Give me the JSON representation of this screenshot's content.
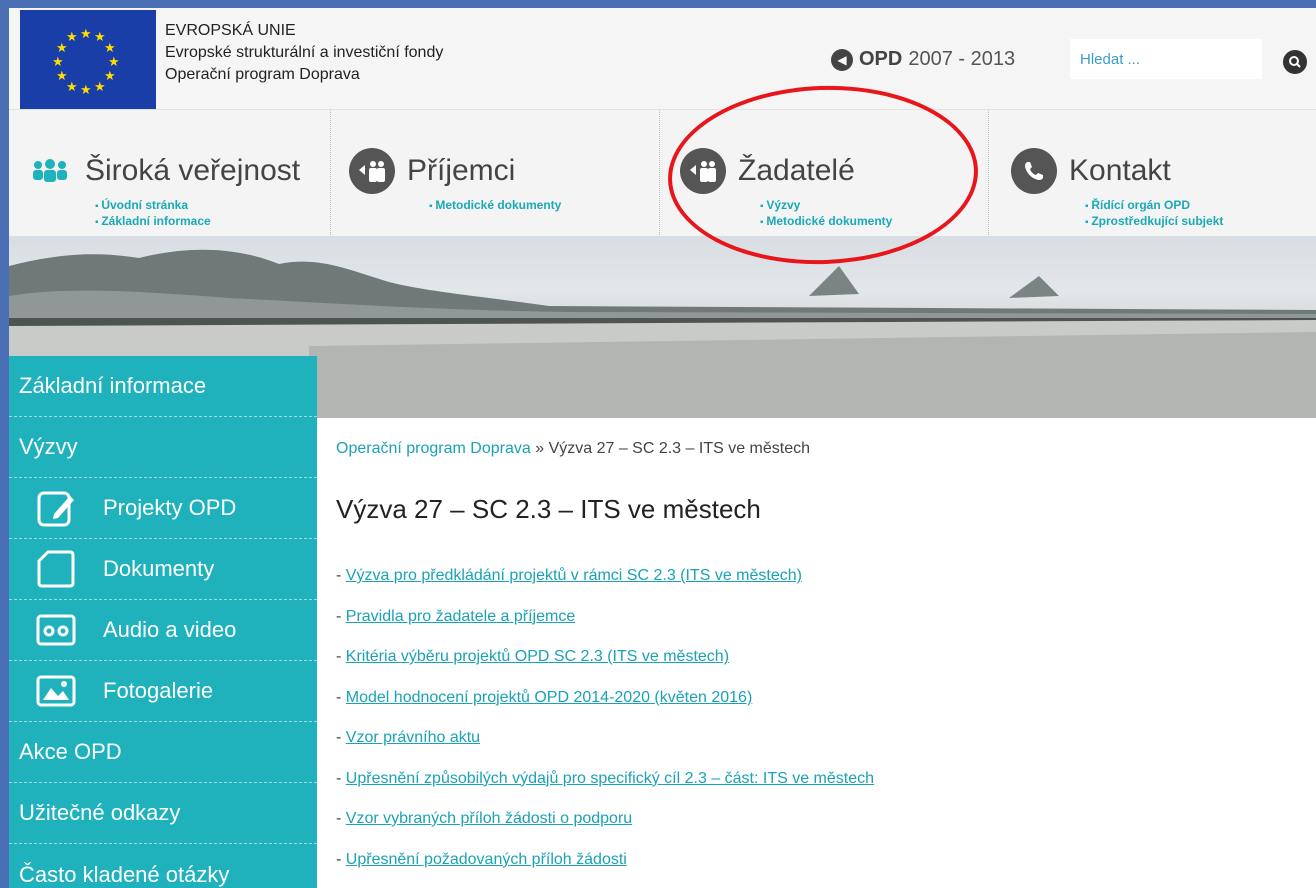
{
  "header": {
    "eu_line1": "EVROPSKÁ UNIE",
    "eu_line2": "Evropské strukturální a investiční fondy",
    "eu_line3": "Operační program Doprava",
    "opd_prefix": "OPD",
    "opd_years": "2007 - 2013",
    "search_placeholder": "Hledat ...",
    "icons": {
      "flag": "eu-flag-icon",
      "back": "arrow-left-circle-icon",
      "search": "search-icon"
    }
  },
  "nav": [
    {
      "title": "Široká veřejnost",
      "icon": "people-icon",
      "links": [
        "Úvodní stránka",
        "Základní informace"
      ]
    },
    {
      "title": "Příjemci",
      "icon": "people-arrow-icon",
      "links": [
        "Metodické dokumenty"
      ]
    },
    {
      "title": "Žadatelé",
      "icon": "people-arrow-icon",
      "links": [
        "Výzvy",
        "Metodické dokumenty"
      ]
    },
    {
      "title": "Kontakt",
      "icon": "phone-icon",
      "links": [
        "Řídící orgán OPD",
        "Zprostředkující subjekt"
      ]
    }
  ],
  "sidebar": {
    "items": [
      {
        "label": "Základní informace"
      },
      {
        "label": "Výzvy"
      },
      {
        "label": "Projekty OPD",
        "icon": "edit-document-icon"
      },
      {
        "label": "Dokumenty",
        "icon": "document-icon"
      },
      {
        "label": "Audio a video",
        "icon": "cassette-icon"
      },
      {
        "label": "Fotogalerie",
        "icon": "image-icon"
      },
      {
        "label": "Akce OPD"
      },
      {
        "label": "Užitečné odkazy"
      },
      {
        "label": "Často kladené otázky"
      }
    ]
  },
  "main": {
    "breadcrumb_link": "Operační program Doprava",
    "breadcrumb_sep": " » ",
    "breadcrumb_current": "Výzva 27 – SC 2.3 – ITS ve městech",
    "title": "Výzva 27 – SC 2.3 – ITS ve městech",
    "documents": [
      "Výzva pro předkládání projektů v rámci SC 2.3 (ITS ve městech)",
      "Pravidla pro žadatele a příjemce",
      "Kritéria výběru projektů OPD SC 2.3 (ITS ve městech)",
      "Model hodnocení projektů OPD 2014-2020 (květen 2016)",
      "Vzor právního aktu",
      "Upřesnění způsobilých výdajů pro specifický cíl 2.3 – část: ITS ve městech",
      "Vzor vybraných příloh žádosti o podporu",
      "Upřesnění požadovaných příloh žádosti"
    ]
  },
  "colors": {
    "accent": "#1fb2bd",
    "link": "#1aa2b5",
    "frame": "#4a6fb5",
    "annotation": "#e8151a"
  }
}
